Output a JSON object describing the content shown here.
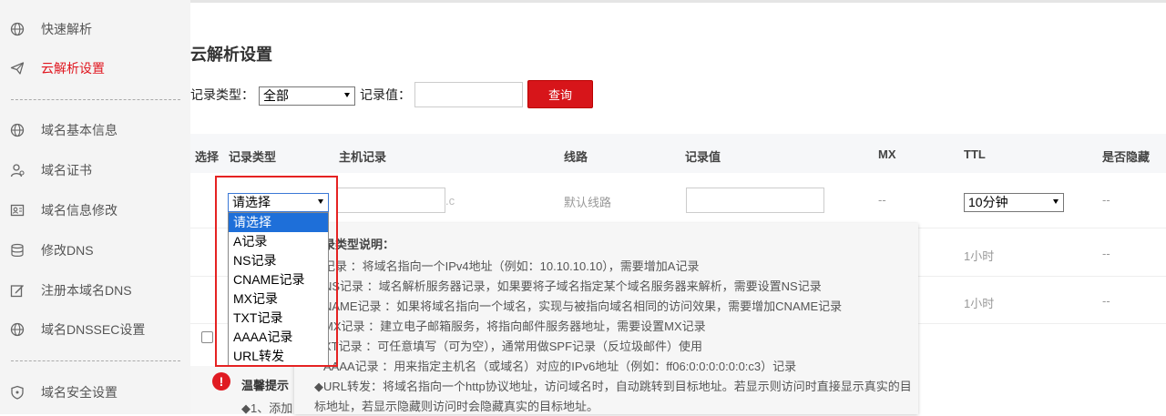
{
  "sidebar": {
    "items": [
      {
        "label": "快速解析",
        "icon": "globe-icon"
      },
      {
        "label": "云解析设置",
        "icon": "paper-plane-icon",
        "active": true
      },
      {
        "label": "域名基本信息",
        "icon": "globe-icon"
      },
      {
        "label": "域名证书",
        "icon": "user-certificate-icon"
      },
      {
        "label": "域名信息修改",
        "icon": "id-card-icon"
      },
      {
        "label": "修改DNS",
        "icon": "database-icon"
      },
      {
        "label": "注册本域名DNS",
        "icon": "edit-icon"
      },
      {
        "label": "域名DNSSEC设置",
        "icon": "globe-icon"
      },
      {
        "label": "域名安全设置",
        "icon": "shield-icon"
      }
    ],
    "accent": "#e0161f"
  },
  "page": {
    "title": "云解析设置"
  },
  "filter": {
    "record_type_label": "记录类型：",
    "record_type_value": "全部",
    "record_value_label": "记录值：",
    "query_button": "查询"
  },
  "table": {
    "headers": [
      "选择",
      "记录类型",
      "主机记录",
      "线路",
      "记录值",
      "MX",
      "TTL",
      "是否隐藏"
    ],
    "row1": {
      "line": "默认线路",
      "mx": "--",
      "ttl": "10分钟",
      "hidden": "--",
      "host_suffix": ".c"
    },
    "row2": {
      "ttl": "1小时",
      "hidden": "--"
    },
    "row3": {
      "ttl": "1小时",
      "hidden": "--"
    }
  },
  "dropdown": {
    "current": "请选择",
    "options": [
      "请选择",
      "A记录",
      "NS记录",
      "CNAME记录",
      "MX记录",
      "TXT记录",
      "AAAA记录",
      "URL转发"
    ]
  },
  "popover": {
    "title": "录类型说明：",
    "lines": [
      "记录 ：将域名指向一个IPv4地址（例如：10.10.10.10），需要增加A记录",
      "NS记录 ：域名解析服务器记录，如果要将子域名指定某个域名服务器来解析，需要设置NS记录",
      "NAME记录 ：如果将域名指向一个域名，实现与被指向域名相同的访问效果，需要增加CNAME记录",
      "MX记录 ：建立电子邮箱服务，将指向邮件服务器地址，需要设置MX记录",
      "XT记录 ：可任意填写（可为空），通常用做SPF记录（反垃圾邮件）使用",
      "AAAA记录 ：用来指定主机名（或域名）对应的IPv6地址（例如：ff06:0:0:0:0:0:0:c3）记录",
      "◆URL转发：将域名指向一个http协议地址，访问域名时，自动跳转到目标地址。若显示则访问时直接显示真实的目",
      "标地址，若显示隐藏则访问时会隐藏真实的目标地址。"
    ]
  },
  "tip": {
    "title": "温馨提示",
    "item1": "◆1、添加"
  }
}
